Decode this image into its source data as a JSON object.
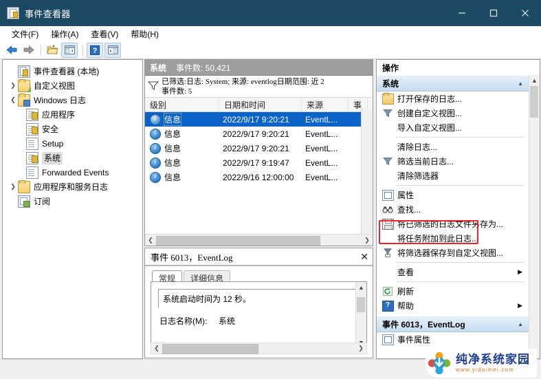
{
  "window": {
    "title": "事件查看器",
    "icon": "event-viewer-icon",
    "controls": {
      "minimize": "–",
      "maximize": "□",
      "close": "✕"
    }
  },
  "menubar": {
    "items": [
      {
        "label": "文件(F)"
      },
      {
        "label": "操作(A)"
      },
      {
        "label": "查看(V)"
      },
      {
        "label": "帮助(H)"
      }
    ]
  },
  "toolbar": {
    "items": [
      {
        "name": "back-icon"
      },
      {
        "name": "forward-icon"
      },
      {
        "name": "open-folder-icon"
      },
      {
        "name": "show-console-tree-icon"
      },
      {
        "name": "help-icon"
      },
      {
        "name": "show-action-pane-icon"
      }
    ]
  },
  "tree": {
    "items": [
      {
        "label": "事件查看器 (本地)",
        "indent": 0,
        "twist": "",
        "icon": "event-viewer-icon",
        "selected": false
      },
      {
        "label": "自定义视图",
        "indent": 1,
        "twist": "›",
        "icon": "folder-green-icon",
        "selected": false
      },
      {
        "label": "Windows 日志",
        "indent": 1,
        "twist": "⌄",
        "icon": "folder-blue-icon",
        "selected": false
      },
      {
        "label": "应用程序",
        "indent": 2,
        "twist": "",
        "icon": "log-warn-icon",
        "selected": false
      },
      {
        "label": "安全",
        "indent": 2,
        "twist": "",
        "icon": "log-warn-icon",
        "selected": false
      },
      {
        "label": "Setup",
        "indent": 2,
        "twist": "",
        "icon": "log-icon",
        "selected": false
      },
      {
        "label": "系统",
        "indent": 2,
        "twist": "",
        "icon": "log-warn-icon",
        "selected": true
      },
      {
        "label": "Forwarded Events",
        "indent": 2,
        "twist": "",
        "icon": "log-icon",
        "selected": false
      },
      {
        "label": "应用程序和服务日志",
        "indent": 1,
        "twist": "›",
        "icon": "folder-plain-icon",
        "selected": false
      },
      {
        "label": "订阅",
        "indent": 1,
        "twist": "",
        "icon": "subscription-icon",
        "selected": false
      }
    ]
  },
  "list": {
    "header": {
      "name": "系统",
      "count": "事件数: 50,421"
    },
    "filter": {
      "icon": "filter-icon",
      "line1": "已筛选:日志: System; 来源: eventlog日期范围: 近 2",
      "line2": "事件数: 5"
    },
    "columns": [
      "级别",
      "日期和时间",
      "来源",
      "事"
    ],
    "rows": [
      {
        "level": "信息",
        "datetime": "2022/9/17 9:20:21",
        "source": "EventL...",
        "selected": true
      },
      {
        "level": "信息",
        "datetime": "2022/9/17 9:20:21",
        "source": "EventL...",
        "selected": false
      },
      {
        "level": "信息",
        "datetime": "2022/9/17 9:20:21",
        "source": "EventL...",
        "selected": false
      },
      {
        "level": "信息",
        "datetime": "2022/9/17 9:19:47",
        "source": "EventL...",
        "selected": false
      },
      {
        "level": "信息",
        "datetime": "2022/9/16 12:00:00",
        "source": "EventL...",
        "selected": false
      }
    ]
  },
  "detail": {
    "title": "事件 6013，EventLog",
    "close": "✕",
    "tabs": [
      {
        "label": "常规",
        "active": true
      },
      {
        "label": "详细信息",
        "active": false
      }
    ],
    "message": "系统启动时间为 12 秒。",
    "fields": [
      {
        "key": "日志名称(M):",
        "value": "系统"
      }
    ]
  },
  "actions": {
    "title": "操作",
    "section1": {
      "label": "系统",
      "collapse": "▲"
    },
    "items1": [
      {
        "label": "打开保存的日志...",
        "icon": "open-log-icon",
        "sep_after": false
      },
      {
        "label": "创建自定义视图...",
        "icon": "create-view-icon",
        "sep_after": false
      },
      {
        "label": "导入自定义视图...",
        "icon": "",
        "sep_after": true
      },
      {
        "label": "清除日志...",
        "icon": "",
        "sep_after": false
      },
      {
        "label": "筛选当前日志...",
        "icon": "filter-icon",
        "sep_after": false,
        "highlighted": true
      },
      {
        "label": "清除筛选器",
        "icon": "",
        "sep_after": true
      },
      {
        "label": "属性",
        "icon": "properties-icon",
        "sep_after": false
      },
      {
        "label": "查找...",
        "icon": "find-icon",
        "sep_after": false
      },
      {
        "label": "将已筛选的日志文件另存为...",
        "icon": "save-icon",
        "sep_after": false
      },
      {
        "label": "将任务附加到此日志...",
        "icon": "",
        "sep_after": false
      },
      {
        "label": "将筛选器保存到自定义视图...",
        "icon": "save-filter-icon",
        "sep_after": true
      },
      {
        "label": "查看",
        "icon": "",
        "submenu": "▶",
        "sep_after": true
      },
      {
        "label": "刷新",
        "icon": "refresh-icon",
        "sep_after": false
      },
      {
        "label": "帮助",
        "icon": "help-icon",
        "submenu": "▶",
        "sep_after": false
      }
    ],
    "section2": {
      "label": "事件 6013，EventLog",
      "collapse": "▲"
    },
    "items2": [
      {
        "label": "事件属性",
        "icon": "properties-icon"
      }
    ]
  },
  "watermark": {
    "name": "纯净系统家园",
    "url": "www.yidaimei.com"
  },
  "colors": {
    "titlebar": "#1c4a63",
    "selection": "#0a64c8",
    "highlight_box": "#e8262d",
    "list_header": "#9d9d9d",
    "section_header": "#c8ddf2"
  }
}
